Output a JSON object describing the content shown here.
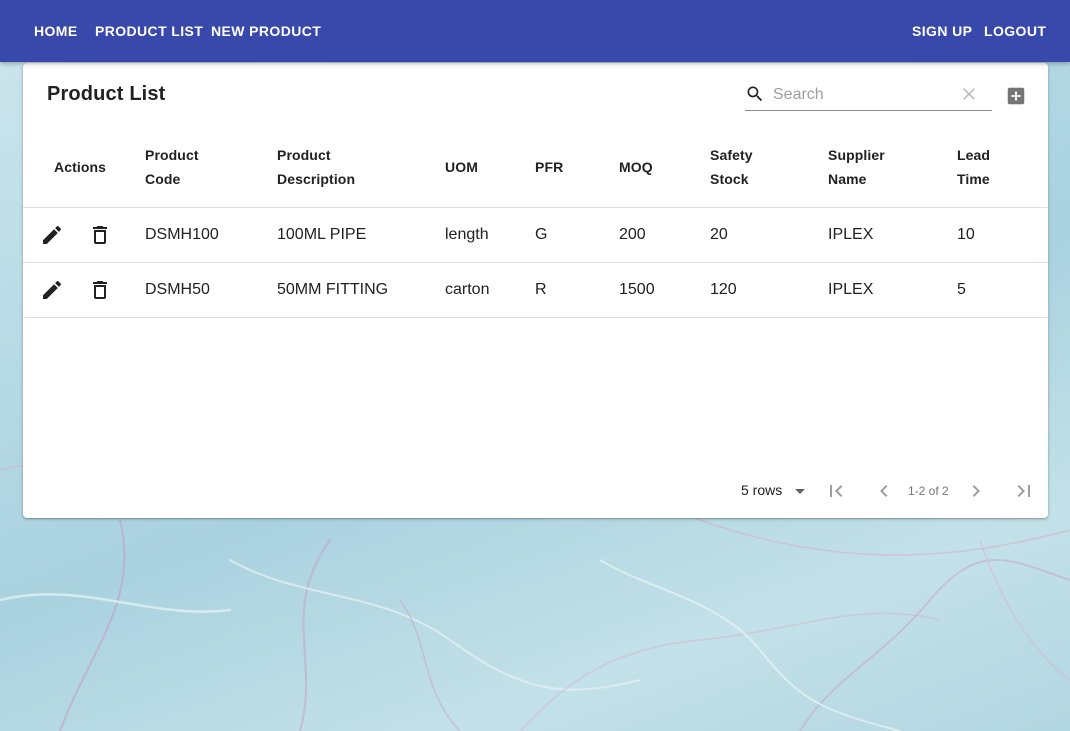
{
  "nav": {
    "home": "HOME",
    "product_list": "PRODUCT LIST",
    "new_product": "NEW PRODUCT",
    "sign_up": "SIGN UP",
    "logout": "LOGOUT"
  },
  "card": {
    "title": "Product List",
    "search_placeholder": "Search"
  },
  "table": {
    "headers": {
      "actions": "Actions",
      "code_1": "Product",
      "code_2": "Code",
      "desc_1": "Product",
      "desc_2": "Description",
      "uom": "UOM",
      "pfr": "PFR",
      "moq": "MOQ",
      "safety_1": "Safety",
      "safety_2": "Stock",
      "supplier_1": "Supplier",
      "supplier_2": "Name",
      "lead_1": "Lead",
      "lead_2": "Time"
    },
    "rows": [
      {
        "code": "DSMH100",
        "description": "100ML PIPE",
        "uom": "length",
        "pfr": "G",
        "moq": "200",
        "safety_stock": "20",
        "supplier": "IPLEX",
        "lead_time": "10"
      },
      {
        "code": "DSMH50",
        "description": "50MM FITTING",
        "uom": "carton",
        "pfr": "R",
        "moq": "1500",
        "safety_stock": "120",
        "supplier": "IPLEX",
        "lead_time": "5"
      }
    ]
  },
  "pagination": {
    "rows_per_page": "5 rows",
    "range": "1-2 of 2"
  },
  "colors": {
    "appbar": "#3949ab",
    "text": "#212121",
    "icon": "#212121",
    "muted_icon": "#757575"
  }
}
